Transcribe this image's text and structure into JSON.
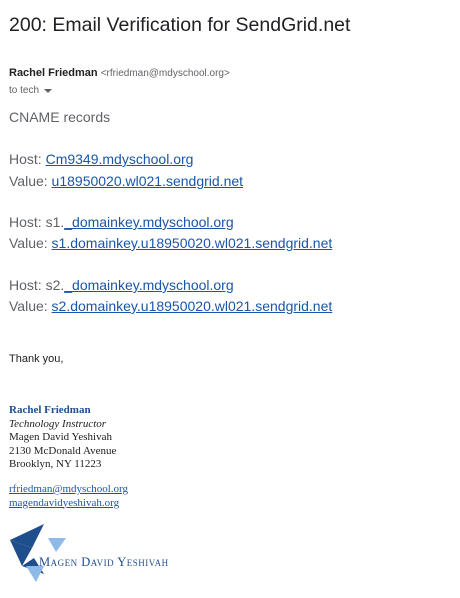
{
  "email": {
    "subject": "200: Email Verification for SendGrid.net",
    "sender_name": "Rachel Friedman",
    "sender_email": "<rfriedman@mdyschool.org>",
    "to_label": "to tech"
  },
  "body": {
    "heading": "CNAME records",
    "records": [
      {
        "host_label": "Host: ",
        "host": "Cm9349.mdyschool.org",
        "value_label": "Value: ",
        "value": "u18950020.wl021.sendgrid.net"
      },
      {
        "host_label": "Host: s1.",
        "host": "_domainkey.mdyschool.org",
        "value_label": "Value: ",
        "value": "s1.domainkey.u18950020.wl021.sendgrid.net"
      },
      {
        "host_label": "Host: s2.",
        "host": "_domainkey.mdyschool.org",
        "value_label": "Value: ",
        "value": "s2.domainkey.u18950020.wl021.sendgrid.net"
      }
    ],
    "closing": "Thank you,"
  },
  "signature": {
    "name": "Rachel Friedman",
    "title": "Technology Instructor",
    "org": "Magen David Yeshivah",
    "address1": "2130 McDonald Avenue",
    "address2": "Brooklyn, NY 11223",
    "email": "rfriedman@mdyschool.org",
    "website": "magendavidyeshivah.org",
    "logo_text": "Magen David Yeshivah"
  },
  "colors": {
    "link": "#1a56a8",
    "logo_dark": "#1f4e8c",
    "logo_light": "#8fb9e6"
  }
}
